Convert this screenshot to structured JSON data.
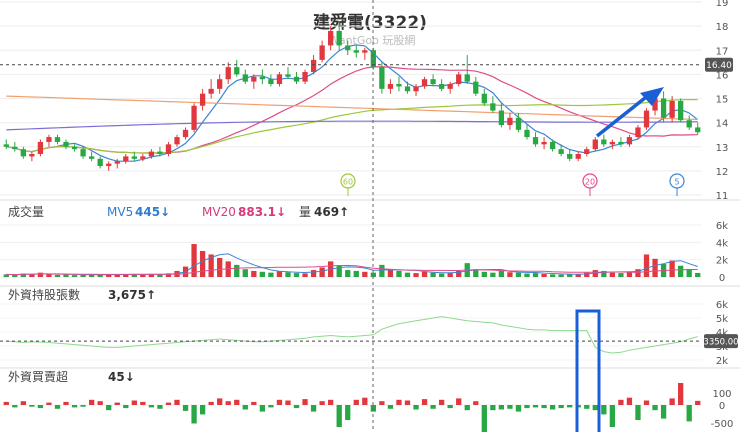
{
  "chart_data": [
    {
      "type": "candlestick",
      "title": "建舜電(3322)",
      "watermark": "WantGoo 玩股網",
      "ylim": [
        11,
        19
      ],
      "y_ticks": [
        "19",
        "18",
        "17",
        "16",
        "15",
        "14",
        "13",
        "12",
        "11"
      ],
      "last_price_label": "16.40",
      "ma_markers": [
        "60",
        "20",
        "5"
      ],
      "candles": [
        [
          13.1,
          13.3,
          12.9,
          13.0
        ],
        [
          13.0,
          13.2,
          12.8,
          12.9
        ],
        [
          12.9,
          13.0,
          12.5,
          12.6
        ],
        [
          12.6,
          12.8,
          12.4,
          12.7
        ],
        [
          12.7,
          13.3,
          12.6,
          13.2
        ],
        [
          13.2,
          13.5,
          13.0,
          13.4
        ],
        [
          13.4,
          13.5,
          13.1,
          13.2
        ],
        [
          13.2,
          13.3,
          12.9,
          13.0
        ],
        [
          13.0,
          13.1,
          12.8,
          12.9
        ],
        [
          12.9,
          13.0,
          12.5,
          12.6
        ],
        [
          12.6,
          12.8,
          12.4,
          12.5
        ],
        [
          12.5,
          12.6,
          12.1,
          12.2
        ],
        [
          12.2,
          12.4,
          12.0,
          12.3
        ],
        [
          12.3,
          12.5,
          12.1,
          12.4
        ],
        [
          12.4,
          12.7,
          12.3,
          12.6
        ],
        [
          12.6,
          12.8,
          12.4,
          12.5
        ],
        [
          12.5,
          12.7,
          12.4,
          12.6
        ],
        [
          12.6,
          12.9,
          12.5,
          12.8
        ],
        [
          12.8,
          13.0,
          12.6,
          12.7
        ],
        [
          12.7,
          13.2,
          12.6,
          13.1
        ],
        [
          13.1,
          13.5,
          13.0,
          13.4
        ],
        [
          13.4,
          13.8,
          13.3,
          13.7
        ],
        [
          13.7,
          14.8,
          13.6,
          14.7
        ],
        [
          14.7,
          15.4,
          14.5,
          15.2
        ],
        [
          15.2,
          15.8,
          15.0,
          15.4
        ],
        [
          15.4,
          16.0,
          15.2,
          15.8
        ],
        [
          15.8,
          16.5,
          15.6,
          16.3
        ],
        [
          16.3,
          16.6,
          15.9,
          16.0
        ],
        [
          16.0,
          16.2,
          15.6,
          15.7
        ],
        [
          15.7,
          16.0,
          15.4,
          15.9
        ],
        [
          15.9,
          16.2,
          15.6,
          15.8
        ],
        [
          15.8,
          16.0,
          15.5,
          15.6
        ],
        [
          15.6,
          16.1,
          15.5,
          16.0
        ],
        [
          16.0,
          16.3,
          15.8,
          15.9
        ],
        [
          15.9,
          16.1,
          15.6,
          15.7
        ],
        [
          15.7,
          16.2,
          15.6,
          16.1
        ],
        [
          16.1,
          16.8,
          16.0,
          16.6
        ],
        [
          16.6,
          17.4,
          16.5,
          17.2
        ],
        [
          17.2,
          18.0,
          17.0,
          17.8
        ],
        [
          17.8,
          18.2,
          17.0,
          17.2
        ],
        [
          17.2,
          17.4,
          16.8,
          17.0
        ],
        [
          17.0,
          17.2,
          16.7,
          16.9
        ],
        [
          16.9,
          17.1,
          16.6,
          17.0
        ],
        [
          17.0,
          17.1,
          16.2,
          16.3
        ],
        [
          16.3,
          16.5,
          15.2,
          15.4
        ],
        [
          15.4,
          15.8,
          15.2,
          15.6
        ],
        [
          15.6,
          15.9,
          15.3,
          15.5
        ],
        [
          15.5,
          15.7,
          15.2,
          15.3
        ],
        [
          15.3,
          15.6,
          15.1,
          15.5
        ],
        [
          15.5,
          15.9,
          15.4,
          15.8
        ],
        [
          15.8,
          16.0,
          15.5,
          15.6
        ],
        [
          15.6,
          15.8,
          15.3,
          15.4
        ],
        [
          15.4,
          15.7,
          15.2,
          15.6
        ],
        [
          15.6,
          16.1,
          15.5,
          16.0
        ],
        [
          16.0,
          16.8,
          15.6,
          15.7
        ],
        [
          15.7,
          15.9,
          15.1,
          15.2
        ],
        [
          15.2,
          15.4,
          14.7,
          14.8
        ],
        [
          14.8,
          15.1,
          14.4,
          14.5
        ],
        [
          14.5,
          14.8,
          13.8,
          13.9
        ],
        [
          13.9,
          14.4,
          13.7,
          14.2
        ],
        [
          14.2,
          14.4,
          13.6,
          13.7
        ],
        [
          13.7,
          13.9,
          13.3,
          13.4
        ],
        [
          13.4,
          13.6,
          13.0,
          13.1
        ],
        [
          13.1,
          13.4,
          12.9,
          13.2
        ],
        [
          13.2,
          13.3,
          12.8,
          12.9
        ],
        [
          12.9,
          13.1,
          12.6,
          12.7
        ],
        [
          12.7,
          12.9,
          12.4,
          12.5
        ],
        [
          12.5,
          12.8,
          12.4,
          12.7
        ],
        [
          12.7,
          13.0,
          12.6,
          12.9
        ],
        [
          12.9,
          13.4,
          12.8,
          13.3
        ],
        [
          13.3,
          13.5,
          13.0,
          13.1
        ],
        [
          13.1,
          13.3,
          12.9,
          13.2
        ],
        [
          13.2,
          13.4,
          13.0,
          13.1
        ],
        [
          13.1,
          13.5,
          13.0,
          13.4
        ],
        [
          13.4,
          13.9,
          13.3,
          13.8
        ],
        [
          13.8,
          14.6,
          13.7,
          14.5
        ],
        [
          14.5,
          15.2,
          14.3,
          15.0
        ],
        [
          15.0,
          15.3,
          14.0,
          14.2
        ],
        [
          14.2,
          15.1,
          14.0,
          14.9
        ],
        [
          14.9,
          15.0,
          14.0,
          14.1
        ],
        [
          14.1,
          14.3,
          13.7,
          13.8
        ],
        [
          13.8,
          14.0,
          13.5,
          13.6
        ]
      ],
      "volume_panel": {
        "label": "成交量",
        "mv5_label": "MV5",
        "mv5_value": "445↓",
        "mv20_label": "MV20",
        "mv20_value": "883.1↓",
        "amount_label": "量",
        "amount_value": "469↑",
        "y_ticks": [
          "6k",
          "4k",
          "2k",
          "0"
        ],
        "values": [
          300,
          250,
          400,
          350,
          500,
          300,
          250,
          280,
          220,
          300,
          260,
          240,
          280,
          300,
          350,
          320,
          260,
          300,
          340,
          420,
          700,
          1200,
          3800,
          3000,
          2600,
          2200,
          1800,
          1400,
          900,
          700,
          600,
          500,
          650,
          550,
          450,
          420,
          800,
          1100,
          1800,
          1300,
          800,
          700,
          600,
          500,
          1400,
          900,
          700,
          500,
          450,
          600,
          500,
          400,
          450,
          700,
          1600,
          900,
          600,
          500,
          700,
          550,
          500,
          400,
          450,
          350,
          300,
          280,
          320,
          360,
          500,
          800,
          700,
          500,
          450,
          600,
          900,
          2600,
          2100,
          1500,
          1900,
          1300,
          900,
          469
        ]
      },
      "foreign_holding_panel": {
        "label": "外資持股張數",
        "value": "3,675↑",
        "y_ticks": [
          "6k",
          "5k",
          "4k",
          "3k",
          "2k"
        ],
        "value_label": "3350.00",
        "values": [
          3350,
          3300,
          3250,
          3300,
          3280,
          3250,
          3200,
          3150,
          3100,
          3050,
          3000,
          2950,
          2900,
          2900,
          2950,
          3000,
          3050,
          3100,
          3150,
          3200,
          3250,
          3300,
          3350,
          3400,
          3450,
          3500,
          3450,
          3400,
          3350,
          3300,
          3300,
          3350,
          3400,
          3450,
          3500,
          3550,
          3650,
          3700,
          3750,
          3700,
          3650,
          3700,
          3750,
          3800,
          4200,
          4400,
          4600,
          4700,
          4800,
          4900,
          5000,
          5100,
          5000,
          4900,
          4800,
          4750,
          4700,
          4650,
          4500,
          4400,
          4300,
          4200,
          4150,
          4150,
          4100,
          4100,
          4100,
          4100,
          4100,
          2900,
          2600,
          2500,
          2550,
          2700,
          2800,
          2900,
          3000,
          3100,
          3200,
          3300,
          3500,
          3675
        ]
      },
      "foreign_trade_panel": {
        "label": "外資買賣超",
        "value": "45↓",
        "y_ticks": [
          "100",
          "0",
          "-500"
        ],
        "values": [
          30,
          -20,
          40,
          -10,
          -30,
          20,
          -40,
          30,
          -20,
          -10,
          60,
          40,
          -60,
          20,
          -30,
          50,
          30,
          -20,
          -40,
          20,
          60,
          -70,
          -250,
          -120,
          30,
          80,
          40,
          60,
          -50,
          30,
          -80,
          -20,
          60,
          50,
          -30,
          70,
          -80,
          40,
          60,
          -300,
          -200,
          60,
          90,
          -80,
          40,
          -40,
          60,
          50,
          -50,
          70,
          -40,
          60,
          -30,
          80,
          -60,
          40,
          -400,
          -60,
          -50,
          -40,
          -80,
          -30,
          -20,
          -30,
          -50,
          -30,
          -20,
          -20,
          -40,
          -60,
          -120,
          -300,
          60,
          90,
          -200,
          50,
          -60,
          -180,
          80,
          300,
          -220,
          45
        ]
      }
    }
  ]
}
